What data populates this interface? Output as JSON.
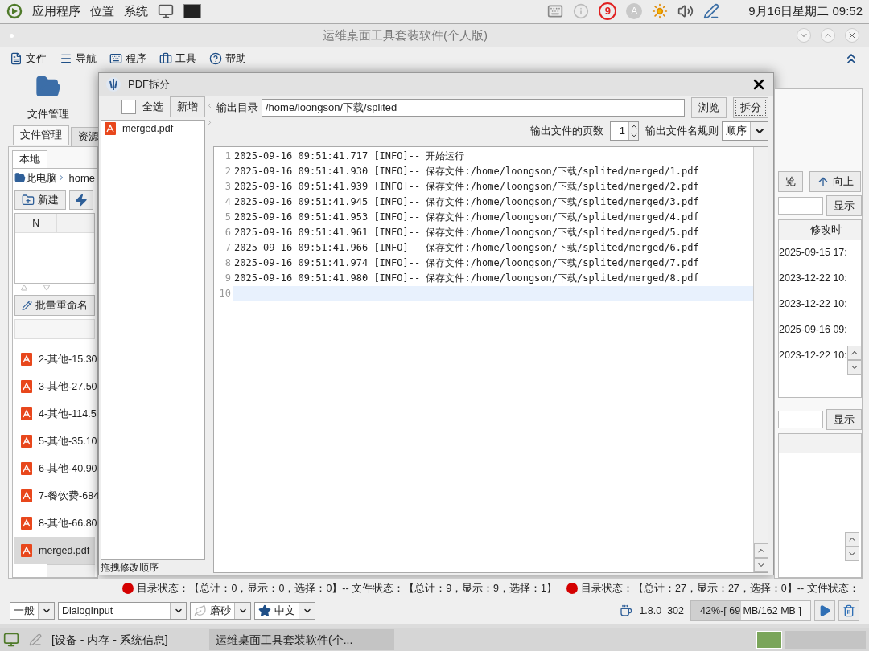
{
  "top_panel": {
    "menus": [
      {
        "label": "应用程序"
      },
      {
        "label": "位置"
      },
      {
        "label": "系统"
      }
    ],
    "tray_marks": [
      "9",
      "A"
    ],
    "clock": "9月16日星期二 09:52"
  },
  "window": {
    "title": "运维桌面工具套装软件(个人版)"
  },
  "menu_bar": [
    {
      "label": "文件",
      "kind": "file"
    },
    {
      "label": "导航",
      "kind": "nav"
    },
    {
      "label": "程序",
      "kind": "program"
    },
    {
      "label": "工具",
      "kind": "tools"
    },
    {
      "label": "帮助",
      "kind": "help"
    }
  ],
  "left_pane": {
    "launcher": "文件管理",
    "tabs": [
      {
        "label": "文件管理",
        "selected": true
      },
      {
        "label": "资源",
        "selected": false
      }
    ],
    "sub_tabs": [
      {
        "label": "本地",
        "selected": true
      }
    ],
    "breadcrumb": [
      "此电脑",
      "home"
    ],
    "new_button": "新建",
    "table_header": "N",
    "rename_button": "批量重命名",
    "files": [
      {
        "name": "2-其他-15.30",
        "selected": false
      },
      {
        "name": "3-其他-27.50",
        "selected": false
      },
      {
        "name": "4-其他-114.5",
        "selected": false
      },
      {
        "name": "5-其他-35.10",
        "selected": false
      },
      {
        "name": "6-其他-40.90",
        "selected": false
      },
      {
        "name": "7-餐饮费-684",
        "selected": false
      },
      {
        "name": "8-其他-66.80",
        "selected": false
      },
      {
        "name": "merged.pdf",
        "selected": true
      }
    ]
  },
  "dialog": {
    "title": "PDF拆分",
    "select_all": {
      "label": "全选",
      "checked": false
    },
    "add_button": "新增",
    "files": [
      {
        "name": "merged.pdf"
      }
    ],
    "hint": "拖拽修改顺序",
    "output_dir_label": "输出目录",
    "output_dir": "/home/loongson/下载/splited",
    "browse": "浏览",
    "split": "拆分",
    "pages_label": "输出文件的页数",
    "pages": "1",
    "rule_label": "输出文件名规则",
    "rule": "顺序",
    "log": [
      {
        "line": "1",
        "text": "2025-09-16 09:51:41.717 [INFO]-- 开始运行",
        "current": false
      },
      {
        "line": "2",
        "text": "2025-09-16 09:51:41.930 [INFO]-- 保存文件:/home/loongson/下载/splited/merged/1.pdf",
        "current": false
      },
      {
        "line": "3",
        "text": "2025-09-16 09:51:41.939 [INFO]-- 保存文件:/home/loongson/下载/splited/merged/2.pdf",
        "current": false
      },
      {
        "line": "4",
        "text": "2025-09-16 09:51:41.945 [INFO]-- 保存文件:/home/loongson/下载/splited/merged/3.pdf",
        "current": false
      },
      {
        "line": "5",
        "text": "2025-09-16 09:51:41.953 [INFO]-- 保存文件:/home/loongson/下载/splited/merged/4.pdf",
        "current": false
      },
      {
        "line": "6",
        "text": "2025-09-16 09:51:41.961 [INFO]-- 保存文件:/home/loongson/下载/splited/merged/5.pdf",
        "current": false
      },
      {
        "line": "7",
        "text": "2025-09-16 09:51:41.966 [INFO]-- 保存文件:/home/loongson/下载/splited/merged/6.pdf",
        "current": false
      },
      {
        "line": "8",
        "text": "2025-09-16 09:51:41.974 [INFO]-- 保存文件:/home/loongson/下载/splited/merged/7.pdf",
        "current": false
      },
      {
        "line": "9",
        "text": "2025-09-16 09:51:41.980 [INFO]-- 保存文件:/home/loongson/下载/splited/merged/8.pdf",
        "current": false
      },
      {
        "line": "10",
        "current": true
      }
    ]
  },
  "right_pane": {
    "browse_partial": "览",
    "up_button": "向上",
    "show_button": "显示",
    "column": "修改时",
    "dates": [
      "2025-09-15 17:",
      "2023-12-22 10:",
      "2023-12-22 10:",
      "2025-09-16 09:",
      "2023-12-22 10:"
    ],
    "show_button_2": "显示"
  },
  "status": [
    "目录状态：【总计：0，显示：0，选择：0】-- 文件状态：【总计：9，显示：9，选择：1】",
    "目录状态：【总计：27，显示：27，选择：0】-- 文件状态："
  ],
  "toolbar": {
    "selects": [
      {
        "kind": "plain",
        "value": "一般"
      },
      {
        "kind": "plain",
        "value": "DialogInput"
      },
      {
        "kind": "leaf",
        "value": "磨砂"
      },
      {
        "kind": "star",
        "value": "中文"
      }
    ],
    "java_version": "1.8.0_302",
    "memory": {
      "text": "42%-[ 69 MB/162 MB ]",
      "level": 0.42
    }
  },
  "taskbar": [
    {
      "label": "[设备 - 内存 - 系统信息]",
      "selected": false
    },
    {
      "label": "运维桌面工具套装软件(个...",
      "selected": true
    }
  ]
}
